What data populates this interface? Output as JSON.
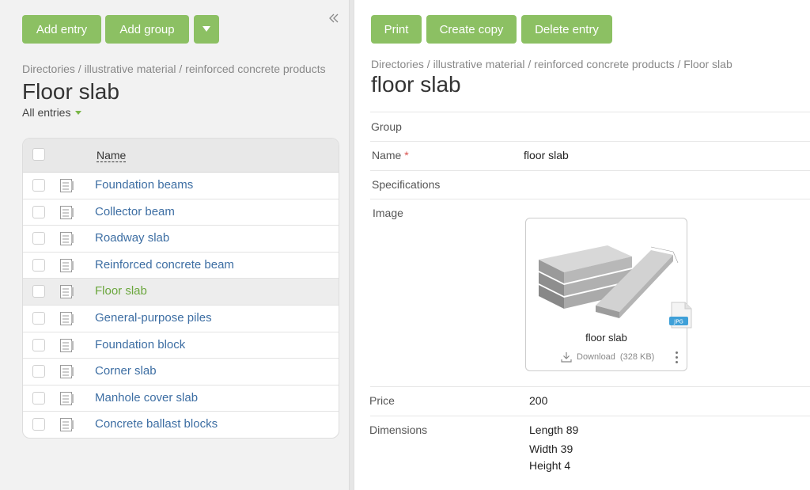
{
  "left": {
    "buttons": {
      "add_entry": "Add entry",
      "add_group": "Add group"
    },
    "breadcrumb": "Directories / illustrative material / reinforced concrete products",
    "title": "Floor slab",
    "filter": "All entries",
    "table": {
      "header": "Name",
      "rows": [
        {
          "label": "Foundation beams",
          "selected": false
        },
        {
          "label": "Collector beam",
          "selected": false
        },
        {
          "label": "Roadway slab",
          "selected": false
        },
        {
          "label": "Reinforced concrete beam",
          "selected": false
        },
        {
          "label": "Floor slab",
          "selected": true
        },
        {
          "label": "General-purpose piles",
          "selected": false
        },
        {
          "label": "Foundation block",
          "selected": false
        },
        {
          "label": "Corner slab",
          "selected": false
        },
        {
          "label": "Manhole cover slab",
          "selected": false
        },
        {
          "label": "Concrete ballast blocks",
          "selected": false
        }
      ]
    }
  },
  "right": {
    "buttons": {
      "print": "Print",
      "create_copy": "Create copy",
      "delete_entry": "Delete entry"
    },
    "breadcrumb": "Directories / illustrative material / reinforced concrete products / Floor slab",
    "title": "floor slab",
    "fields": {
      "group_label": "Group",
      "name_label": "Name",
      "name_required": "*",
      "name_value": "floor slab",
      "specs_label": "Specifications",
      "image_label": "Image",
      "price_label": "Price",
      "price_value": "200",
      "dimensions_label": "Dimensions",
      "dimensions_lines": [
        "Length 89",
        "Width 39",
        "Height 4"
      ]
    },
    "image_card": {
      "caption": "floor slab",
      "download": "Download",
      "size": "(328 KB)",
      "file_badge": "JPG"
    }
  },
  "colors": {
    "accent_green": "#8cc063",
    "link_blue": "#3d6ea3",
    "selected_green": "#6aa63c"
  }
}
